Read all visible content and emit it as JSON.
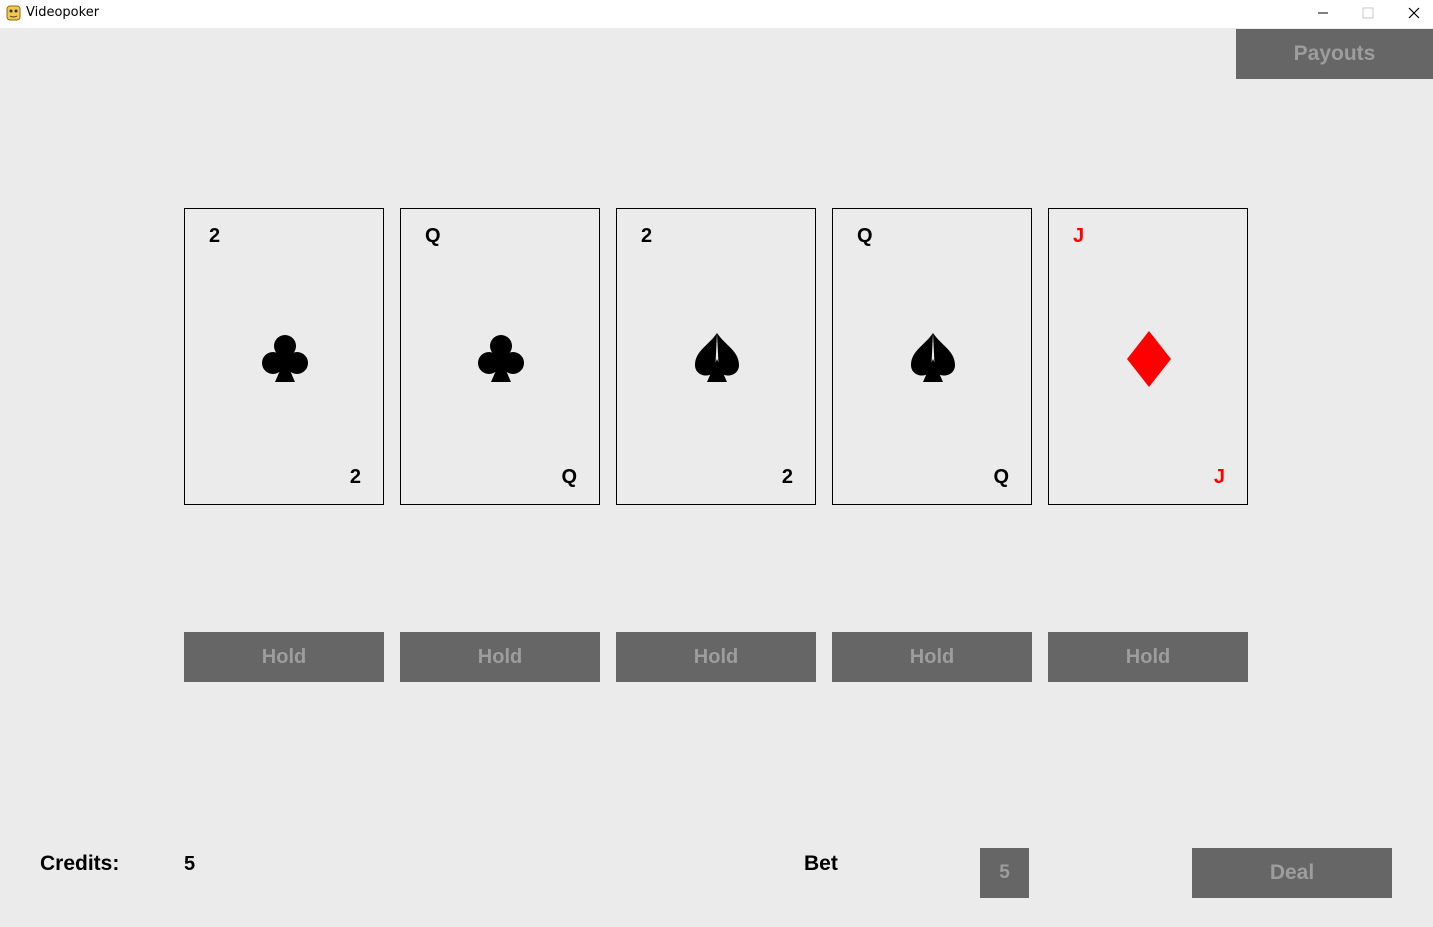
{
  "window": {
    "title": "Videopoker",
    "icon": "python-icon"
  },
  "header": {
    "payouts_label": "Payouts"
  },
  "cards": [
    {
      "rank": "2",
      "suit": "clubs",
      "color": "#000000"
    },
    {
      "rank": "Q",
      "suit": "clubs",
      "color": "#000000"
    },
    {
      "rank": "2",
      "suit": "spades",
      "color": "#000000"
    },
    {
      "rank": "Q",
      "suit": "spades",
      "color": "#000000"
    },
    {
      "rank": "J",
      "suit": "diamonds",
      "color": "#ff0000"
    }
  ],
  "hold_buttons": [
    "Hold",
    "Hold",
    "Hold",
    "Hold",
    "Hold"
  ],
  "footer": {
    "credits_label": "Credits:",
    "credits_value": "5",
    "bet_label": "Bet",
    "bet_value": "5",
    "deal_label": "Deal"
  },
  "colors": {
    "background": "#ebebeb",
    "button_bg": "#666666",
    "button_text": "#9d9d9d",
    "red_suit": "#ff0000"
  }
}
